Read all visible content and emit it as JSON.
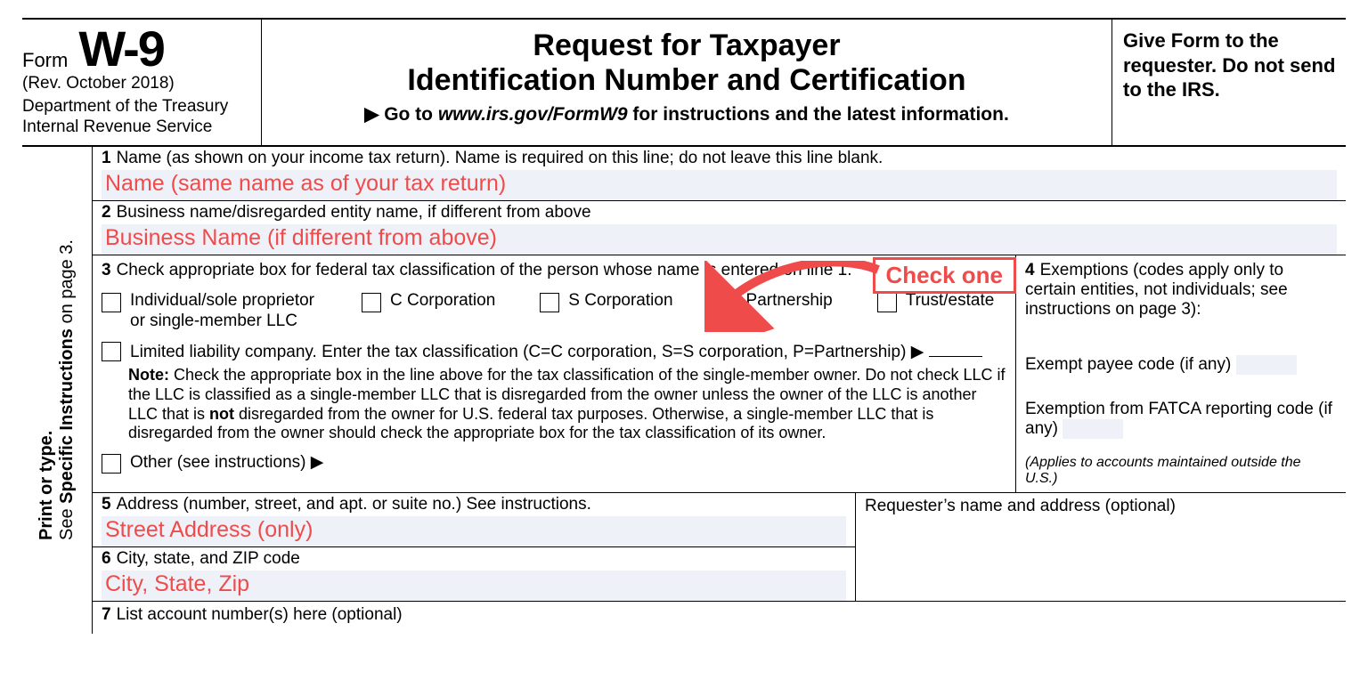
{
  "header": {
    "form_word": "Form",
    "form_code": "W-9",
    "rev": "(Rev. October 2018)",
    "dept1": "Department of the Treasury",
    "dept2": "Internal Revenue Service",
    "title1": "Request for Taxpayer",
    "title2": "Identification Number and Certification",
    "goto_prefix": "▶ Go to ",
    "goto_url": "www.irs.gov/FormW9",
    "goto_suffix": " for instructions and the latest information.",
    "right": "Give Form to the requester. Do not send to the IRS."
  },
  "side": {
    "a": "Print or type.",
    "b": "See ",
    "c": "Specific Instructions",
    "d": " on page 3."
  },
  "l1": {
    "num": "1",
    "text": "Name (as shown on your income tax return). Name is required on this line; do not leave this line blank.",
    "fill": "Name (same name as of your tax return)"
  },
  "l2": {
    "num": "2",
    "text": "Business name/disregarded entity name, if different from above",
    "fill": "Business Name (if different from above)"
  },
  "l3": {
    "num": "3",
    "text": "Check appropriate box for federal tax classification of the person whose name is entered on line 1.",
    "opt1": "Individual/sole proprietor or single-member LLC",
    "opt2": "C Corporation",
    "opt3": "S Corporation",
    "opt4": "Partnership",
    "opt5": "Trust/estate",
    "llc": "Limited liability company. Enter the tax classification (C=C corporation, S=S corporation, P=Partnership) ▶",
    "note_label": "Note:",
    "note_a": " Check the appropriate box in the line above for the tax classification of the single-member owner.  Do not check LLC if the LLC is classified as a single-member LLC that is disregarded from the owner unless the owner of the LLC is another LLC that is ",
    "note_b": "not",
    "note_c": " disregarded from the owner for U.S. federal tax purposes. Otherwise, a single-member LLC that is disregarded from the owner should check the appropriate box for the tax classification of its owner.",
    "other": "Other (see instructions) ▶",
    "callout": "Check one"
  },
  "l4": {
    "num": "4",
    "text": "Exemptions (codes apply only to certain entities, not individuals; see instructions on page 3):",
    "payee": "Exempt payee code (if any)",
    "fatca": "Exemption from FATCA reporting code (if any)",
    "small": "(Applies to accounts maintained outside the U.S.)"
  },
  "l5": {
    "num": "5",
    "text": "Address (number, street, and apt. or suite no.) See instructions.",
    "fill": "Street Address (only)"
  },
  "l6": {
    "num": "6",
    "text": "City, state, and ZIP code",
    "fill": "City, State, Zip"
  },
  "requester": "Requester’s name and address (optional)",
  "l7": {
    "num": "7",
    "text": "List account number(s) here (optional)"
  }
}
